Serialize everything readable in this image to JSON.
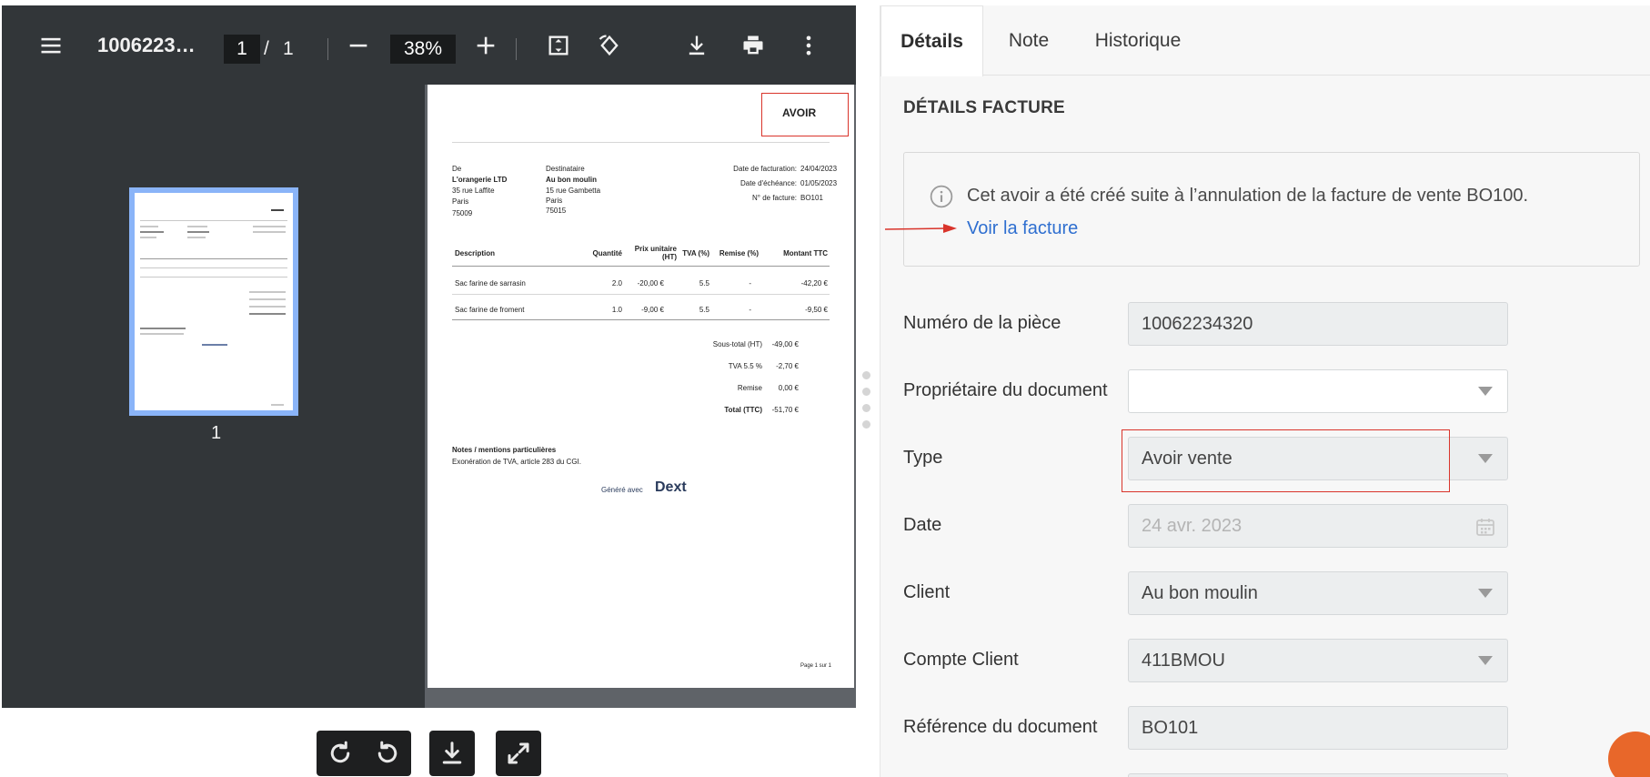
{
  "viewer": {
    "file_name": "1006223…",
    "page_current": "1",
    "page_separator": "/",
    "page_total": "1",
    "zoom": "38%",
    "thumbnail_label": "1"
  },
  "invoice": {
    "title": "AVOIR",
    "from_label": "De",
    "from_name": "L'orangerie LTD",
    "from_street": "35 rue Laffite",
    "from_city": "Paris",
    "from_zip": "75009",
    "to_label": "Destinataire",
    "to_name": "Au bon moulin",
    "to_street": "15 rue Gambetta",
    "to_city": "Paris",
    "to_zip": "75015",
    "meta": [
      {
        "label": "Date de facturation:",
        "value": "24/04/2023"
      },
      {
        "label": "Date d'échéance:",
        "value": "01/05/2023"
      },
      {
        "label": "N° de facture:",
        "value": "BO101"
      }
    ],
    "columns": [
      "Description",
      "Quantité",
      "Prix unitaire (HT)",
      "TVA (%)",
      "Remise (%)",
      "Montant TTC"
    ],
    "rows": [
      [
        "Sac farine de sarrasin",
        "2.0",
        "-20,00 €",
        "5.5",
        "-",
        "-42,20 €"
      ],
      [
        "Sac farine de froment",
        "1.0",
        "-9,00 €",
        "5.5",
        "-",
        "-9,50 €"
      ]
    ],
    "totals": [
      {
        "label": "Sous-total (HT)",
        "value": "-49,00 €"
      },
      {
        "label": "TVA 5.5 %",
        "value": "-2,70 €"
      },
      {
        "label": "Remise",
        "value": "0,00 €"
      },
      {
        "label": "Total (TTC)",
        "value": "-51,70 €"
      }
    ],
    "notes_title": "Notes / mentions particulières",
    "notes_text": "Exonération de TVA, article 283 du CGI.",
    "generated_with": "Généré avec",
    "brand": "Dext",
    "page_footer": "Page 1 sur 1"
  },
  "tabs": [
    {
      "label": "Détails",
      "active": true
    },
    {
      "label": "Note",
      "active": false
    },
    {
      "label": "Historique",
      "active": false
    }
  ],
  "details": {
    "section_title": "DÉTAILS FACTURE",
    "info_text": "Cet avoir a été créé suite à l’annulation de la facture de vente BO100.",
    "info_link": "Voir la facture",
    "fields": [
      {
        "label": "Numéro de la pièce",
        "value": "10062234320",
        "kind": "text"
      },
      {
        "label": "Propriétaire du document",
        "value": "",
        "kind": "select"
      },
      {
        "label": "Type",
        "value": "Avoir vente",
        "kind": "select"
      },
      {
        "label": "Date",
        "value": "24 avr. 2023",
        "kind": "date"
      },
      {
        "label": "Client",
        "value": "Au bon moulin",
        "kind": "select"
      },
      {
        "label": "Compte Client",
        "value": "411BMOU",
        "kind": "select"
      },
      {
        "label": "Référence du document",
        "value": "BO101",
        "kind": "text"
      }
    ]
  },
  "colors": {
    "viewer_bg": "#323639",
    "highlight_red": "#d9342b",
    "link_blue": "#2f6fd0",
    "thumb_border": "#8ab4f8"
  }
}
